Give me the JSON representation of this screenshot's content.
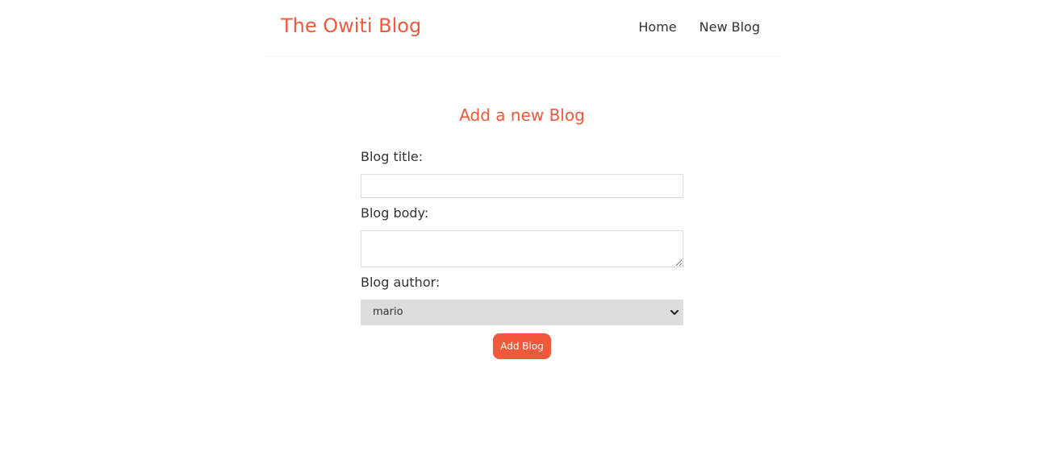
{
  "navbar": {
    "brand": "The Owiti Blog",
    "links": [
      {
        "label": "Home"
      },
      {
        "label": "New Blog"
      }
    ]
  },
  "create": {
    "title": "Add a new Blog",
    "title_label": "Blog title:",
    "title_value": "",
    "body_label": "Blog body:",
    "body_value": "",
    "author_label": "Blog author:",
    "author_selected": "mario",
    "submit_label": "Add Blog"
  },
  "colors": {
    "accent": "#f1593a",
    "text": "#333333",
    "select_bg": "#dddddd",
    "border": "#dddddd"
  },
  "icons": {
    "select_arrow": "chevron-down-icon"
  }
}
